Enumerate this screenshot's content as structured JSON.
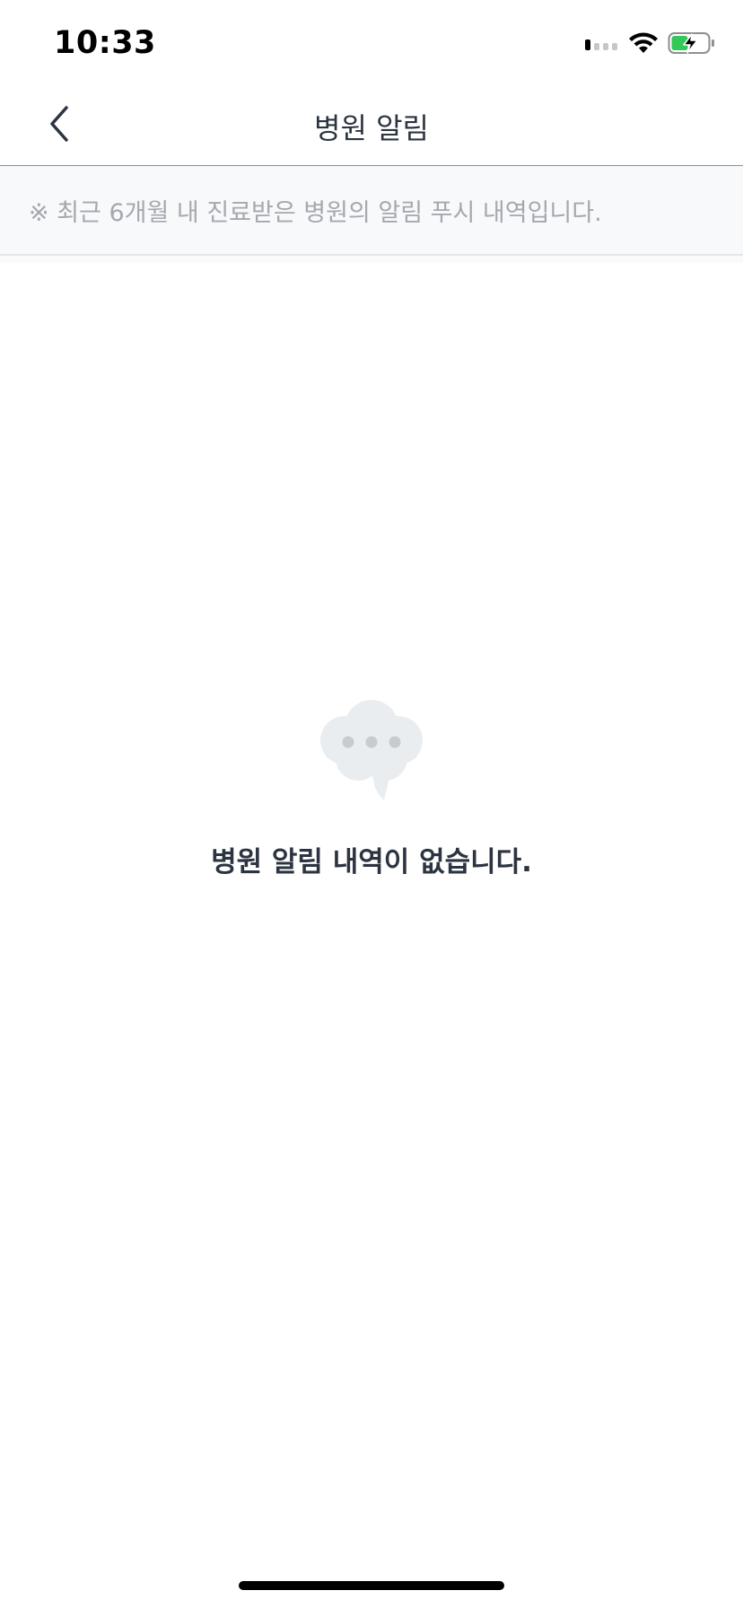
{
  "status_bar": {
    "time": "10:33",
    "icons": [
      "cellular-signal-icon",
      "wifi-icon",
      "battery-charging-icon"
    ]
  },
  "nav": {
    "title": "병원 알림",
    "back_icon": "chevron-left-icon"
  },
  "notice": {
    "text": "※ 최근 6개월 내 진료받은 병원의 알림 푸시 내역입니다."
  },
  "empty_state": {
    "icon": "speech-bubble-icon",
    "message": "병원 알림 내역이 없습니다."
  },
  "colors": {
    "title_text": "#2b3440",
    "notice_text": "#a4a9ae",
    "notice_background": "#f7f9fb",
    "battery_green": "#34c759"
  }
}
